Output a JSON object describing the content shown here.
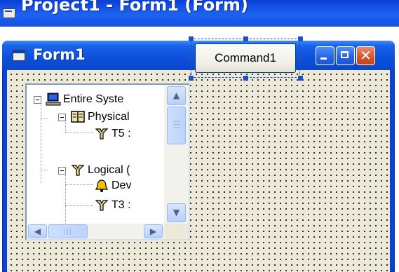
{
  "ide": {
    "title": "Project1 - Form1 (Form)"
  },
  "form": {
    "title": "Form1",
    "caption_buttons": {
      "minimize": "minimize-icon",
      "maximize": "maximize-icon",
      "close": "close-icon"
    }
  },
  "tree": {
    "nodes": [
      {
        "label": "Entire Syste",
        "icon": "computer-icon",
        "expander": "minus"
      },
      {
        "label": "Physical",
        "icon": "book-icon",
        "expander": "minus"
      },
      {
        "label": "T5 :",
        "icon": "network-tap-icon",
        "expander": ""
      },
      {
        "label": "Logical (",
        "icon": "network-tap-icon",
        "expander": "minus"
      },
      {
        "label": "Dev",
        "icon": "bell-icon",
        "expander": ""
      },
      {
        "label": "T3 :",
        "icon": "network-tap-icon",
        "expander": ""
      }
    ],
    "scroll_icons": {
      "up": "arrow-up-icon",
      "down": "arrow-down-icon",
      "left": "arrow-left-icon",
      "right": "arrow-right-icon"
    }
  },
  "command_button": {
    "label": "Command1"
  },
  "colors": {
    "title_blue": "#0b43d6",
    "form_face": "#ece9d8",
    "close_red": "#d6532f",
    "selection_handle": "#2050c8"
  }
}
